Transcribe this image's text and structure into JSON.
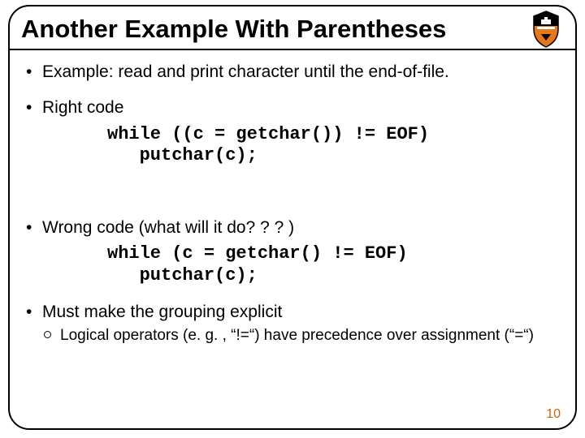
{
  "title": "Another Example With Parentheses",
  "bullets": {
    "b1": "Example: read and print character until the end-of-file.",
    "b2": "Right code",
    "b3": "Wrong code (what will it do? ? ? )",
    "b4": "Must make the grouping explicit",
    "sub1": "Logical operators (e. g. , “!=“) have precedence over assignment (“=“)"
  },
  "code": {
    "right": "while ((c = getchar()) != EOF)\n   putchar(c);",
    "wrong": "while (c = getchar() != EOF)\n   putchar(c);"
  },
  "page_number": "10",
  "logo_name": "princeton-shield-icon"
}
